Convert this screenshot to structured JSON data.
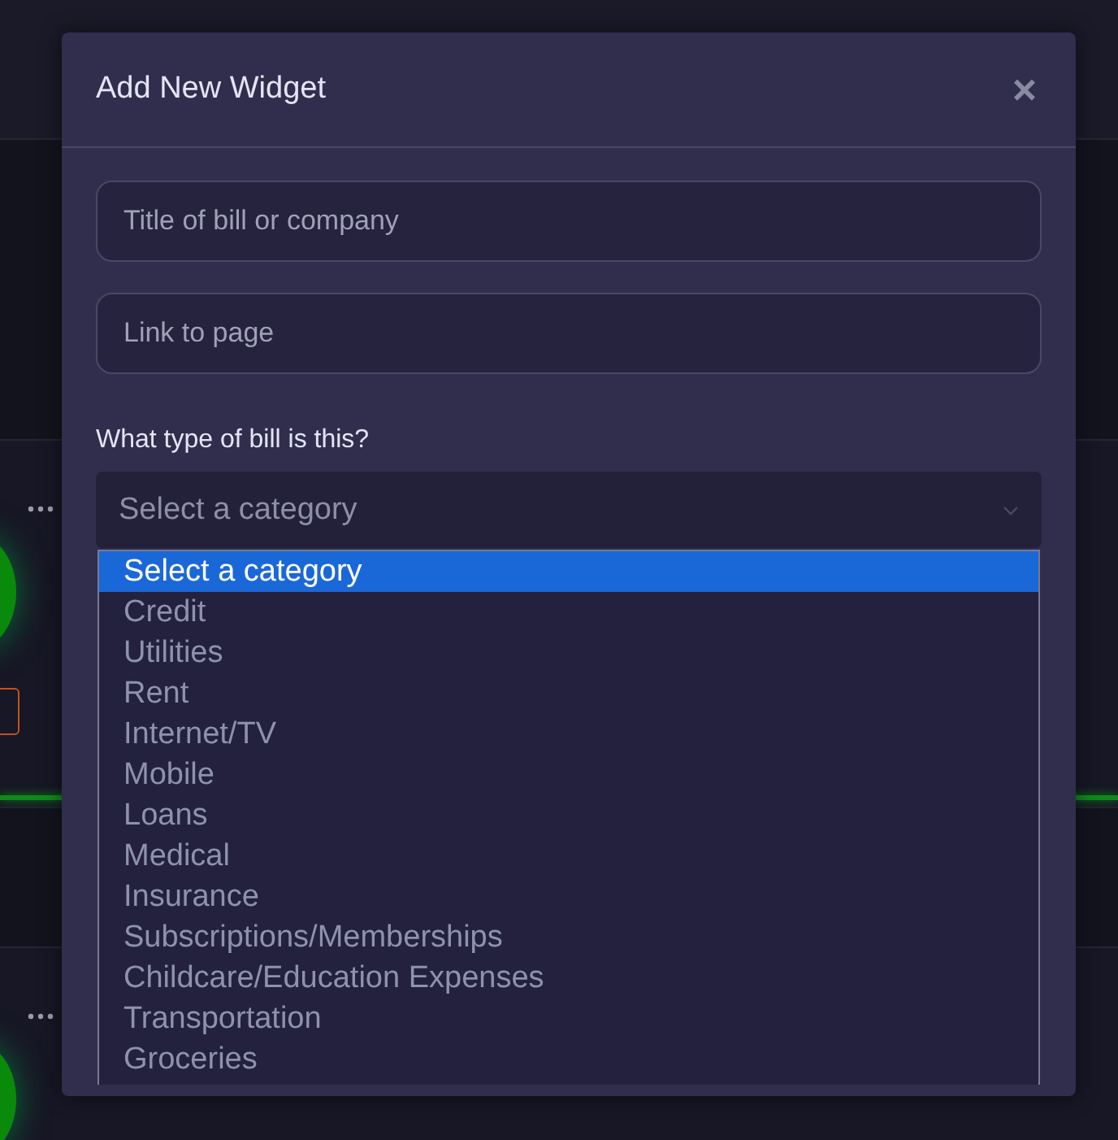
{
  "modal": {
    "title": "Add New Widget",
    "close_label": "×"
  },
  "fields": [
    {
      "placeholder": "Title of bill or company"
    },
    {
      "placeholder": "Link to page"
    }
  ],
  "category": {
    "label": "What type of bill is this?",
    "placeholder": "Select a category",
    "options": [
      {
        "label": "Select a category",
        "selected": true
      },
      {
        "label": "Credit",
        "selected": false
      },
      {
        "label": "Utilities",
        "selected": false
      },
      {
        "label": "Rent",
        "selected": false
      },
      {
        "label": "Internet/TV",
        "selected": false
      },
      {
        "label": "Mobile",
        "selected": false
      },
      {
        "label": "Loans",
        "selected": false
      },
      {
        "label": "Medical",
        "selected": false
      },
      {
        "label": "Insurance",
        "selected": false
      },
      {
        "label": "Subscriptions/Memberships",
        "selected": false
      },
      {
        "label": "Childcare/Education Expenses",
        "selected": false
      },
      {
        "label": "Transportation",
        "selected": false
      },
      {
        "label": "Groceries",
        "selected": false
      }
    ]
  }
}
